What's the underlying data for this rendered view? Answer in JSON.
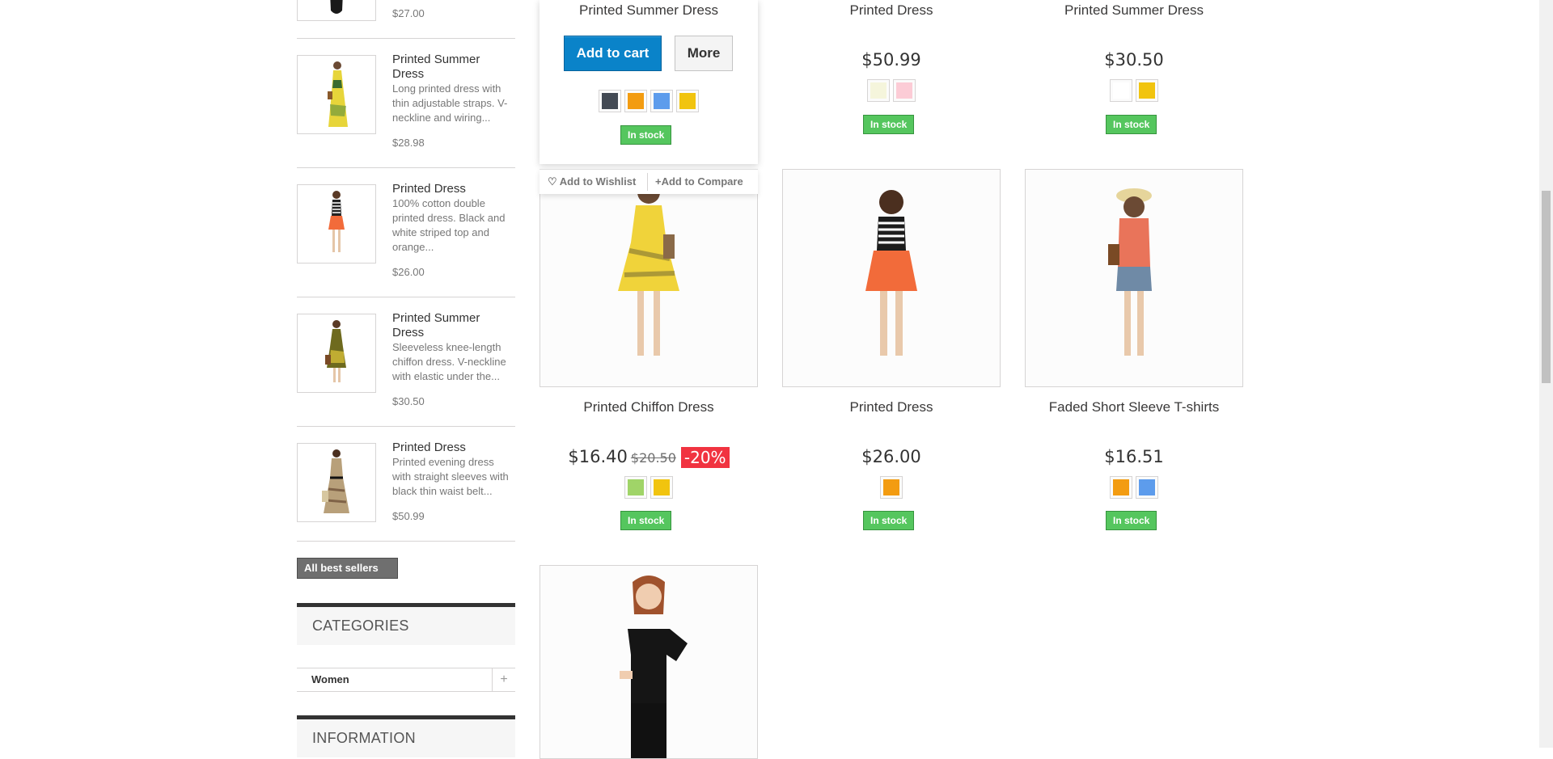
{
  "sidebar": {
    "best_sellers": [
      {
        "name": "",
        "desc": "",
        "price": "$27.00"
      },
      {
        "name": "Printed Summer Dress",
        "desc": "Long printed dress with thin adjustable straps. V-neckline and wiring...",
        "price": "$28.98"
      },
      {
        "name": "Printed Dress",
        "desc": "100% cotton double printed dress. Black and white striped top and orange...",
        "price": "$26.00"
      },
      {
        "name": "Printed Summer Dress",
        "desc": "Sleeveless knee-length chiffon dress. V-neckline with elastic under the...",
        "price": "$30.50"
      },
      {
        "name": "Printed Dress",
        "desc": "Printed evening dress with straight sleeves with black thin waist belt...",
        "price": "$50.99"
      }
    ],
    "all_best_sellers_label": "All best sellers",
    "categories_title": "Categories",
    "categories": [
      {
        "label": "Women"
      }
    ],
    "information_title": "Information"
  },
  "products": [
    {
      "name": "Printed Summer Dress",
      "price": "",
      "colors": [
        "#434a54",
        "#f39c11",
        "#5d9cec",
        "#f1c40f"
      ],
      "stock": "In stock",
      "add_to_cart": "Add to cart",
      "more": "More",
      "wishlist": "Add to Wishlist",
      "compare": "Add to Compare"
    },
    {
      "name": "Printed Dress",
      "price": "$50.99",
      "colors": [
        "#f5f5dc",
        "#fcccd6"
      ],
      "stock": "In stock"
    },
    {
      "name": "Printed Summer Dress",
      "price": "$30.50",
      "colors": [
        "#ffffff",
        "#f1c40f"
      ],
      "stock": "In stock"
    },
    {
      "name": "Printed Chiffon Dress",
      "price": "$16.40",
      "old_price": "$20.50",
      "discount": "-20%",
      "colors": [
        "#a0d468",
        "#f1c40f"
      ],
      "stock": "In stock"
    },
    {
      "name": "Printed Dress",
      "price": "$26.00",
      "colors": [
        "#f39c11"
      ],
      "stock": "In stock"
    },
    {
      "name": "Faded Short Sleeve T-shirts",
      "price": "$16.51",
      "colors": [
        "#f39c11",
        "#5d9cec"
      ],
      "stock": "In stock"
    },
    {
      "name": "",
      "price": "",
      "colors": [],
      "stock": ""
    }
  ]
}
